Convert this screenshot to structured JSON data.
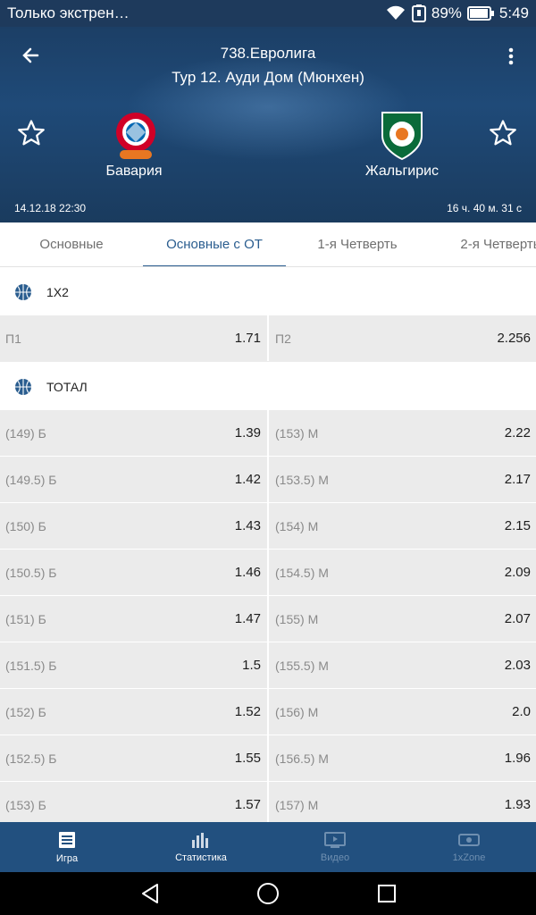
{
  "status": {
    "notification": "Только экстрен…",
    "battery": "89%",
    "time": "5:49"
  },
  "header": {
    "league": "738.Евролига",
    "round": "Тур 12. Ауди Дом (Мюнхен)",
    "home_team": "Бавария",
    "away_team": "Жальгирис",
    "datetime": "14.12.18 22:30",
    "countdown": "16 ч. 40 м. 31 с"
  },
  "tabs": [
    "Основные",
    "Основные с ОТ",
    "1-я Четверть",
    "2-я Четверть"
  ],
  "sections": {
    "x12": {
      "title": "1X2",
      "rows": [
        {
          "left_label": "П1",
          "left_value": "1.71",
          "right_label": "П2",
          "right_value": "2.256"
        }
      ]
    },
    "total": {
      "title": "ТОТАЛ",
      "rows": [
        {
          "left_label": "(149) Б",
          "left_value": "1.39",
          "right_label": "(153) М",
          "right_value": "2.22"
        },
        {
          "left_label": "(149.5) Б",
          "left_value": "1.42",
          "right_label": "(153.5) М",
          "right_value": "2.17"
        },
        {
          "left_label": "(150) Б",
          "left_value": "1.43",
          "right_label": "(154) М",
          "right_value": "2.15"
        },
        {
          "left_label": "(150.5) Б",
          "left_value": "1.46",
          "right_label": "(154.5) М",
          "right_value": "2.09"
        },
        {
          "left_label": "(151) Б",
          "left_value": "1.47",
          "right_label": "(155) М",
          "right_value": "2.07"
        },
        {
          "left_label": "(151.5) Б",
          "left_value": "1.5",
          "right_label": "(155.5) М",
          "right_value": "2.03"
        },
        {
          "left_label": "(152) Б",
          "left_value": "1.52",
          "right_label": "(156) М",
          "right_value": "2.0"
        },
        {
          "left_label": "(152.5) Б",
          "left_value": "1.55",
          "right_label": "(156.5) М",
          "right_value": "1.96"
        },
        {
          "left_label": "(153) Б",
          "left_value": "1.57",
          "right_label": "(157) М",
          "right_value": "1.93"
        }
      ]
    }
  },
  "bottom_nav": [
    {
      "label": "Игра",
      "icon": "game-icon",
      "active": true
    },
    {
      "label": "Статистика",
      "icon": "statistics-icon",
      "active": true
    },
    {
      "label": "Видео",
      "icon": "video-icon",
      "active": false
    },
    {
      "label": "1xZone",
      "icon": "zone-icon",
      "active": false
    }
  ],
  "colors": {
    "header_bg": "#1f4a78",
    "accent": "#2a5d8f",
    "bottom_nav_bg": "#22507f"
  }
}
